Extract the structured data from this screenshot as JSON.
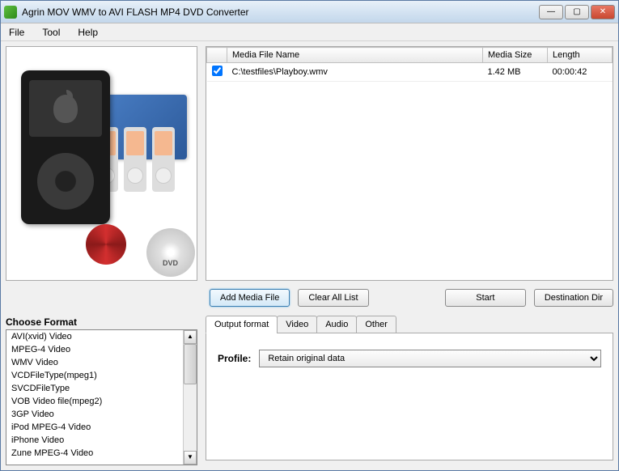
{
  "window": {
    "title": "Agrin MOV WMV to AVI FLASH MP4 DVD Converter"
  },
  "menu": {
    "file": "File",
    "tool": "Tool",
    "help": "Help"
  },
  "fileTable": {
    "headers": {
      "name": "Media File Name",
      "size": "Media Size",
      "length": "Length"
    },
    "rows": [
      {
        "checked": true,
        "name": "C:\\testfiles\\Playboy.wmv",
        "size": "1.42 MB",
        "length": "00:00:42"
      }
    ]
  },
  "buttons": {
    "addMedia": "Add Media File",
    "clearAll": "Clear All List",
    "start": "Start",
    "destDir": "Destination Dir"
  },
  "formatPanel": {
    "title": "Choose Format",
    "items": [
      "AVI(xvid) Video",
      "MPEG-4 Video",
      "WMV Video",
      "VCDFileType(mpeg1)",
      "SVCDFileType",
      "VOB Video file(mpeg2)",
      "3GP Video",
      "iPod MPEG-4 Video",
      "iPhone Video",
      "Zune MPEG-4 Video"
    ]
  },
  "outputPanel": {
    "tabs": {
      "output": "Output format",
      "video": "Video",
      "audio": "Audio",
      "other": "Other"
    },
    "profileLabel": "Profile:",
    "profileValue": "Retain original data"
  },
  "dvdLabel": "DVD"
}
